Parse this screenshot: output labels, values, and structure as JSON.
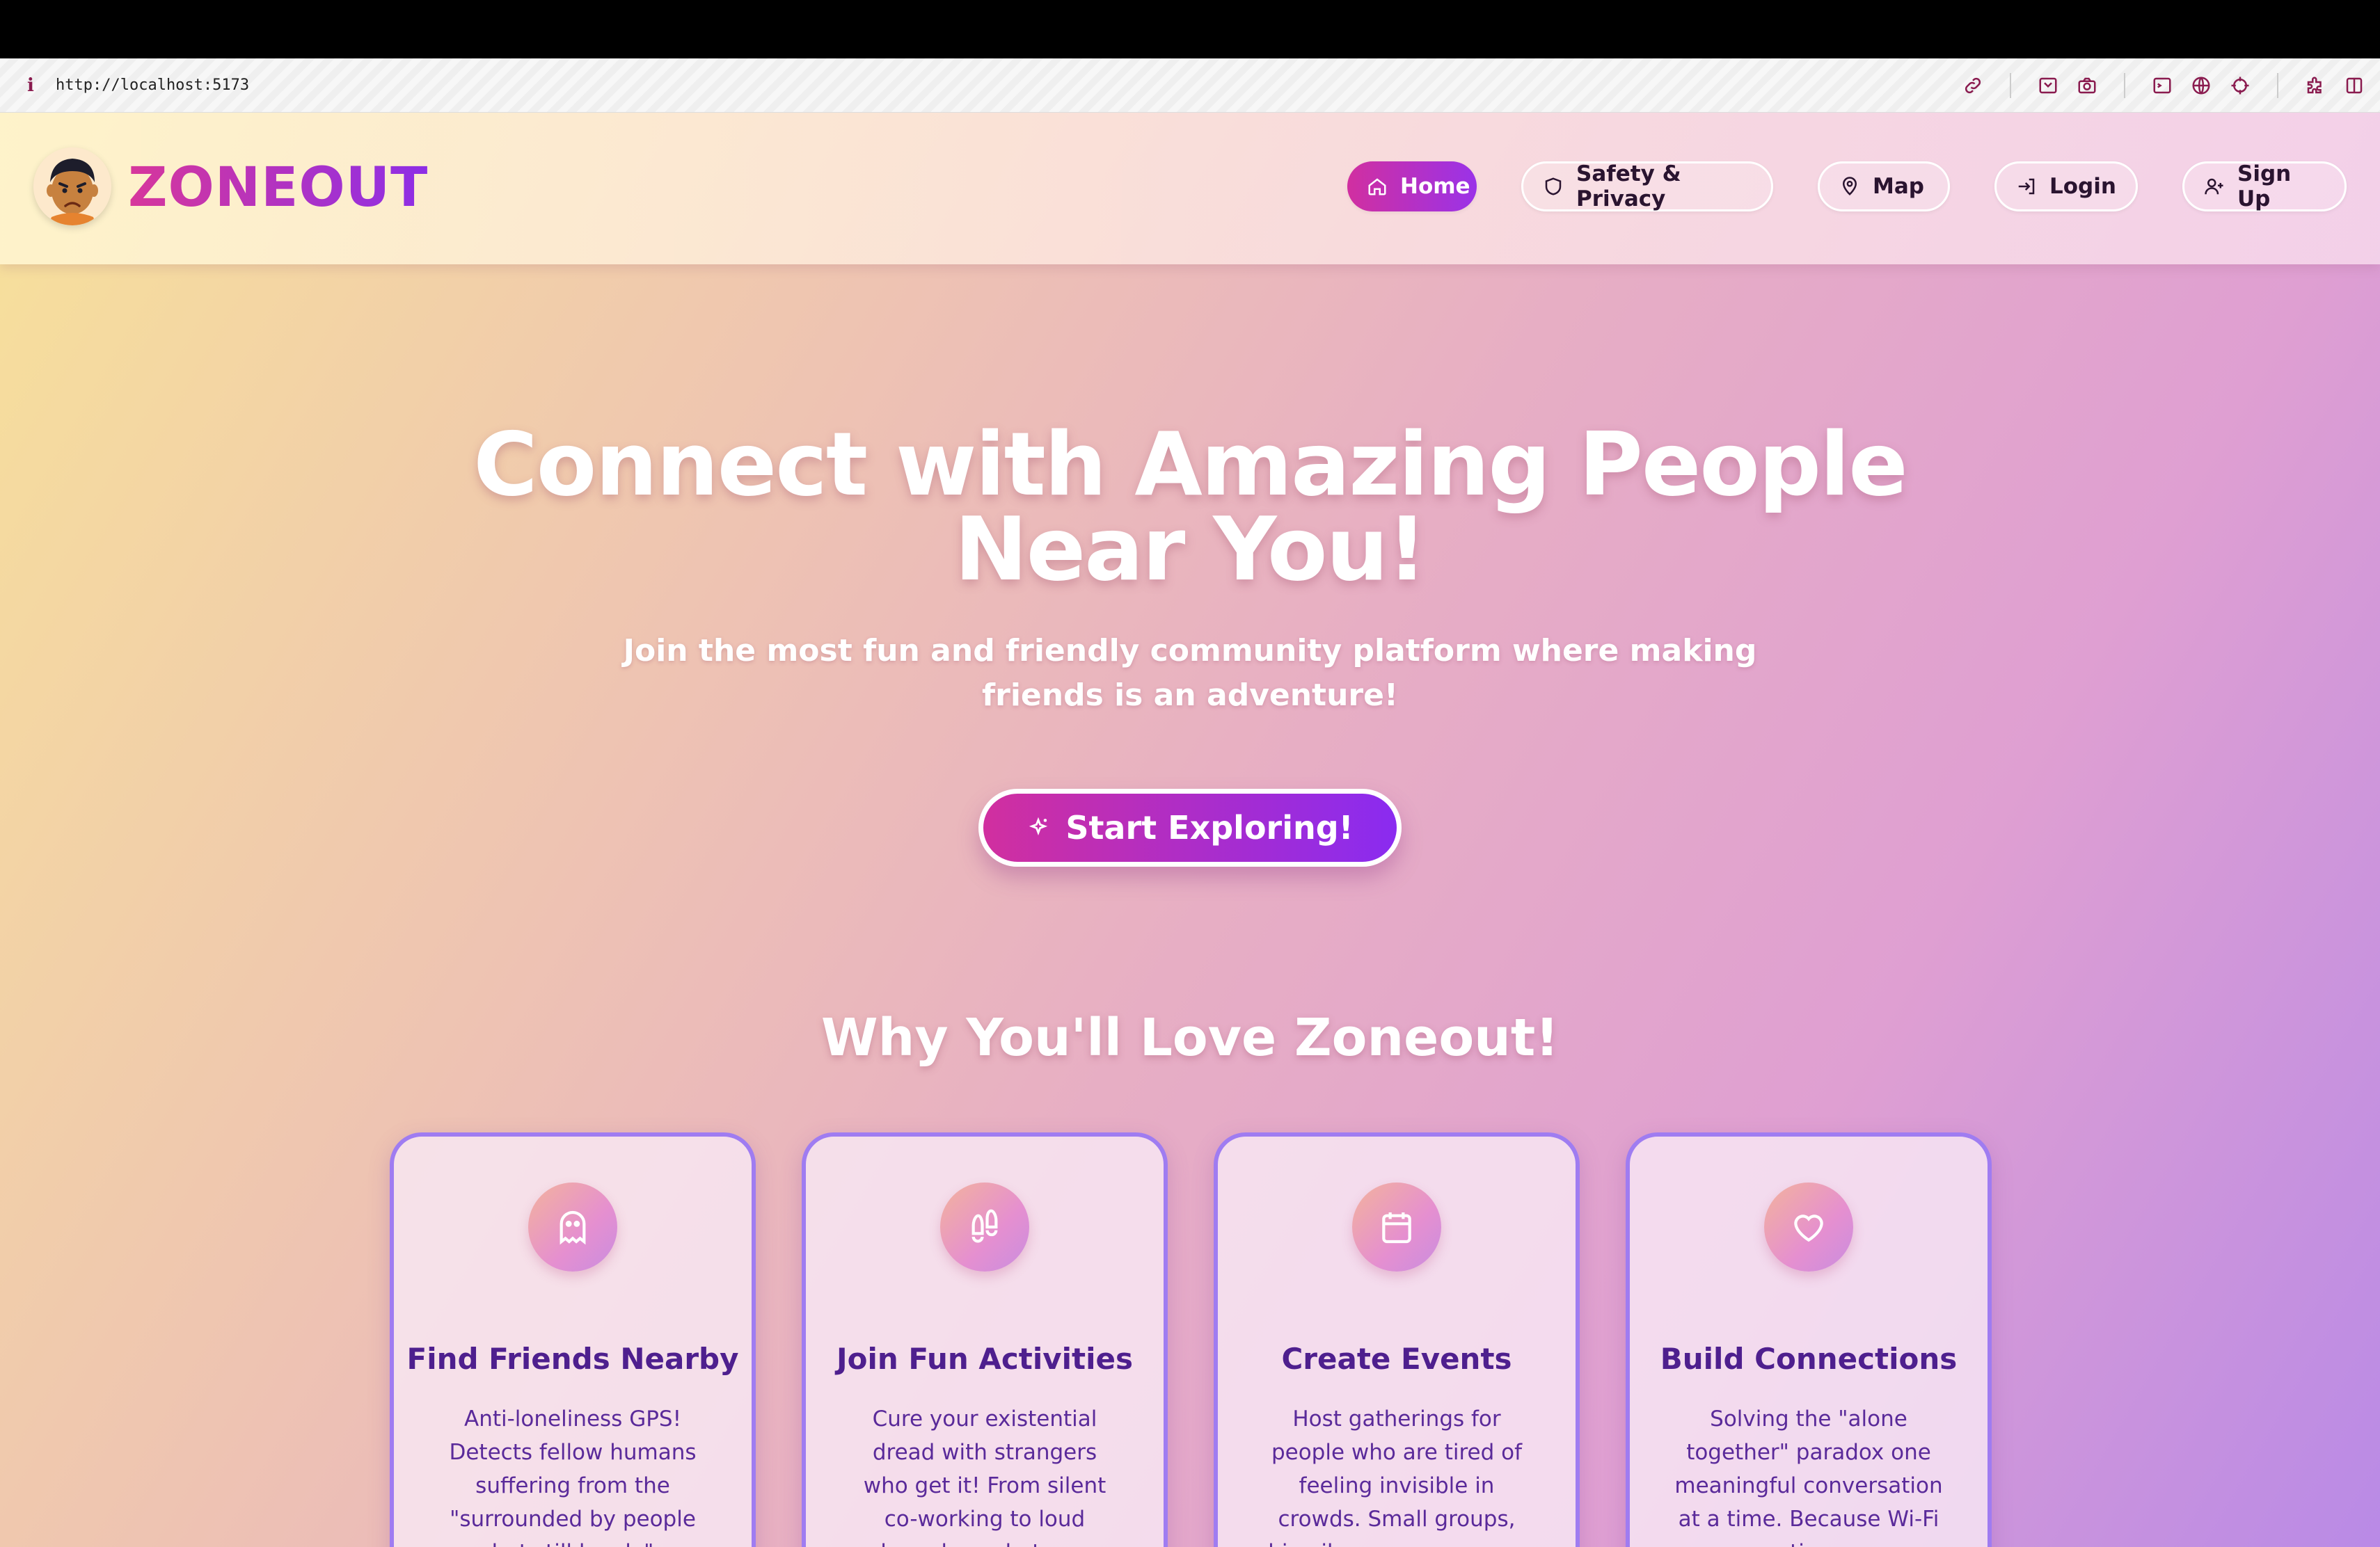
{
  "browser": {
    "url": "http://localhost:5173",
    "tool_icons": [
      "link-icon",
      "save-icon",
      "camera-icon",
      "terminal-icon",
      "globe-icon",
      "crosshair-icon",
      "extensions-icon",
      "sidebar-icon"
    ]
  },
  "nav": {
    "brand": "ZONEOUT",
    "items": [
      {
        "label": "Home",
        "icon": "home-icon",
        "active": true
      },
      {
        "label": "Safety & Privacy",
        "icon": "shield-icon",
        "active": false
      },
      {
        "label": "Map",
        "icon": "map-pin-icon",
        "active": false
      },
      {
        "label": "Login",
        "icon": "login-icon",
        "active": false
      },
      {
        "label": "Sign Up",
        "icon": "user-plus-icon",
        "active": false
      }
    ]
  },
  "hero": {
    "title_line1": "Connect with Amazing People",
    "title_line2": "Near You!",
    "subtitle": "Join the most fun and friendly community platform where making friends is an adventure!",
    "cta_label": "Start Exploring!",
    "cta_icon": "sparkles-icon"
  },
  "features": {
    "title": "Why You'll Love Zoneout!",
    "cards": [
      {
        "icon": "ghost-icon",
        "title": "Find Friends Nearby",
        "description": "Anti-loneliness GPS! Detects fellow humans suffering from the \"surrounded by people but still lonely\" syndrome"
      },
      {
        "icon": "footprints-icon",
        "title": "Join Fun Activities",
        "description": "Cure your existential dread with strangers who get it! From silent co-working to loud karaoke - whatever awkwardly suits you best"
      },
      {
        "icon": "calendar-icon",
        "title": "Create Events",
        "description": "Host gatherings for people who are tired of feeling invisible in crowds. Small groups, big vibes, zero pressure while you..."
      },
      {
        "icon": "heart-icon",
        "title": "Build Connections",
        "description": "Solving the \"alone together\" paradox one meaningful conversation at a time. Because Wi-Fi connections are..."
      }
    ]
  },
  "colors": {
    "brand_gradient_start": "#d7379b",
    "brand_gradient_end": "#8d2ee6",
    "card_border": "#9f7cf1",
    "card_text": "#4e1f8e"
  }
}
